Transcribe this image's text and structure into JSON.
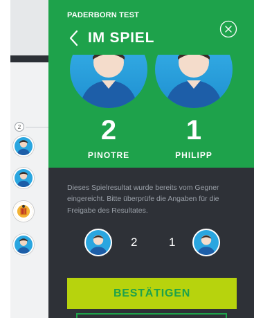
{
  "match": {
    "subtitle": "PADERBORN TEST",
    "title": "IM SPIEL"
  },
  "players": [
    {
      "name": "PINOTRE",
      "score": "2"
    },
    {
      "name": "PHILIPP",
      "score": "1"
    }
  ],
  "info_text": "Dieses Spielresultat wurde bereits vom Gegner eingereicht. Bitte überprüfe die Angaben für die Freigabe des Resultates.",
  "summary": {
    "score_left": "2",
    "score_right": "1"
  },
  "actions": {
    "confirm_label": "BESTÄTIGEN"
  },
  "background": {
    "badge": "2"
  },
  "colors": {
    "green": "#1ea24b",
    "dark_panel": "#2e3137",
    "confirm_button": "#b7d30d",
    "avatar_blue": "#2aa6e0"
  },
  "icons": [
    "back-chevron-icon",
    "close-circle-icon",
    "avatar-icon",
    "club-crest-icon"
  ]
}
